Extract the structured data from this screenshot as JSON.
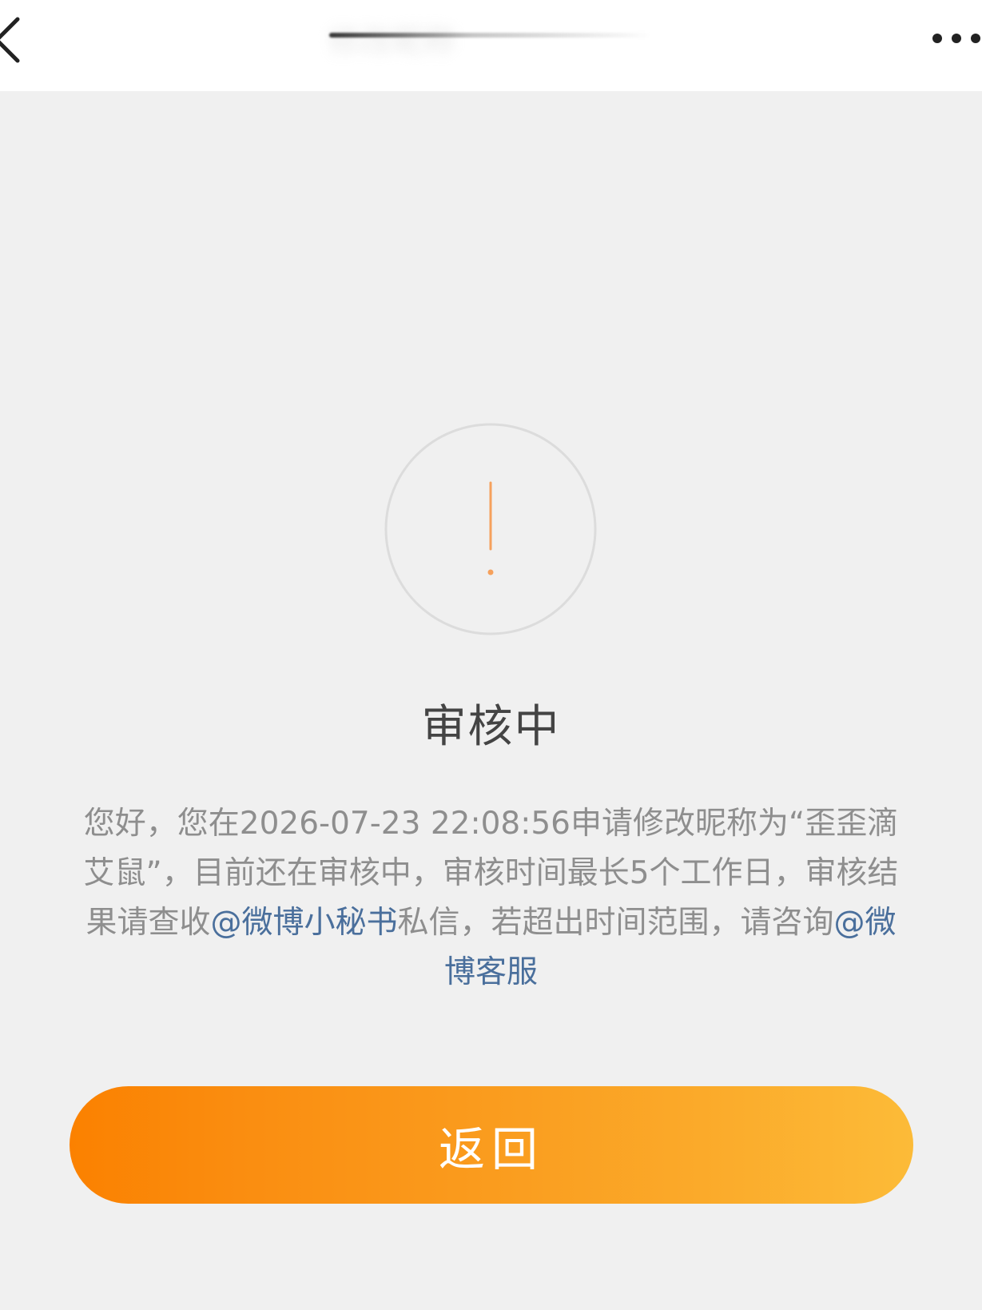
{
  "nav": {
    "title": "修改昵称",
    "back_icon": "chevron-left-icon",
    "more_icon": "more-horizontal-icon"
  },
  "status": {
    "icon": "exclamation-circle-icon",
    "accent_color": "#f6a15c",
    "title": "审核中"
  },
  "message": {
    "part1": "您好，您在2026-07-23 22:08:56申请修改昵称为“歪歪滴艾鼠”，目前还在审核中，审核时间最长5个工作日，审核结果请查收",
    "link1": "@微博小秘书",
    "part2": "私信，若超出时间范围，请咨询",
    "link2": "@微博客服"
  },
  "button": {
    "label": "返回",
    "gradient_start": "#fb8100",
    "gradient_end": "#fcbb38"
  }
}
